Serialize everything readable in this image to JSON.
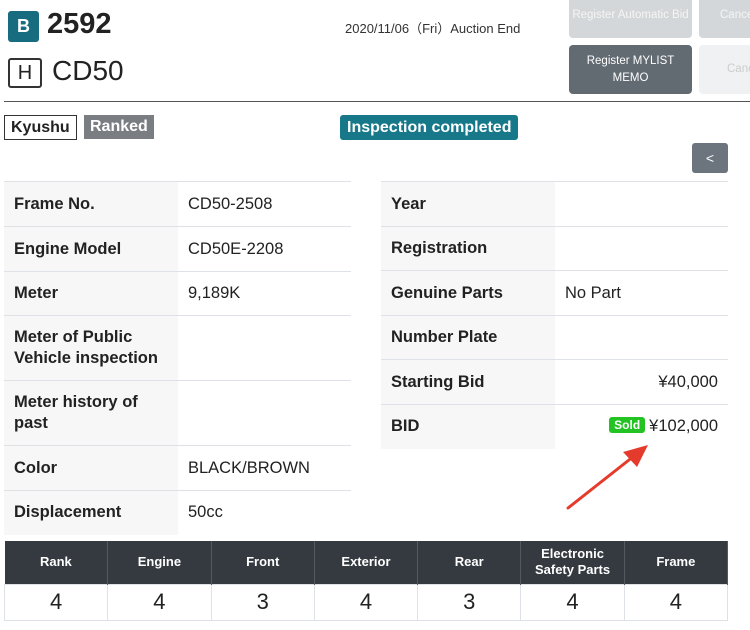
{
  "header": {
    "lane_code": "B",
    "lot_number": "2592",
    "type_code": "H",
    "model": "CD50",
    "auction_date": "2020/11/06（Fri）Auction End",
    "buttons": {
      "register_automatic_bid": "Register Automatic Bid",
      "cancel_1": "Cance",
      "register_mylist_memo": "Register MYLIST MEMO",
      "cancel_2": "Canc"
    }
  },
  "tags": {
    "region": "Kyushu",
    "ranked": "Ranked",
    "inspection": "Inspection completed",
    "back": "<"
  },
  "left_specs": [
    {
      "label": "Frame No.",
      "value": "CD50-2508"
    },
    {
      "label": "Engine Model",
      "value": "CD50E-2208"
    },
    {
      "label": "Meter",
      "value": "9,189K"
    },
    {
      "label": "Meter of Public Vehicle inspection",
      "value": ""
    },
    {
      "label": "Meter history of past",
      "value": ""
    },
    {
      "label": "Color",
      "value": "BLACK/BROWN"
    },
    {
      "label": "Displacement",
      "value": "50cc"
    }
  ],
  "right_specs": [
    {
      "label": "Year",
      "value": ""
    },
    {
      "label": "Registration",
      "value": ""
    },
    {
      "label": "Genuine Parts",
      "value": "No Part"
    },
    {
      "label": "Number Plate",
      "value": ""
    },
    {
      "label": "Starting Bid",
      "value": "¥40,000"
    },
    {
      "label": "BID",
      "value": "¥102,000",
      "status": "Sold"
    }
  ],
  "grades": {
    "headers": [
      "Rank",
      "Engine",
      "Front",
      "Exterior",
      "Rear",
      "Electronic Safety Parts",
      "Frame"
    ],
    "values": [
      "4",
      "4",
      "3",
      "4",
      "3",
      "4",
      "4"
    ]
  },
  "colors": {
    "accent_teal": "#17788a",
    "sold_green": "#22c322",
    "annotation_red": "#e53b2c",
    "dark_header": "#343a40"
  }
}
